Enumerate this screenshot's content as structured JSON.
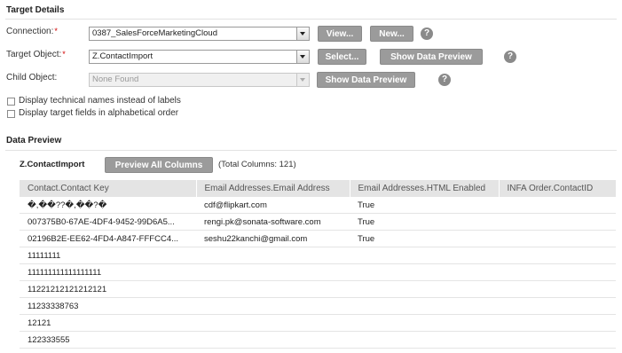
{
  "target_details": {
    "title": "Target Details",
    "connection": {
      "label": "Connection:",
      "required_mark": "*",
      "value": "0387_SalesForceMarketingCloud",
      "view_label": "View...",
      "new_label": "New..."
    },
    "target_object": {
      "label": "Target Object:",
      "required_mark": "*",
      "value": "Z.ContactImport",
      "select_label": "Select...",
      "preview_label": "Show Data Preview"
    },
    "child_object": {
      "label": "Child Object:",
      "value": "None Found",
      "preview_label": "Show Data Preview"
    },
    "help_glyph": "?",
    "options": [
      {
        "label": "Display technical names instead of labels",
        "checked": false
      },
      {
        "label": "Display target fields in alphabetical order",
        "checked": false
      }
    ]
  },
  "data_preview": {
    "title": "Data Preview",
    "object_name": "Z.ContactImport",
    "preview_all_label": "Preview All Columns",
    "total_columns": "(Total Columns: 121)",
    "columns": [
      "Contact.Contact Key",
      "Email Addresses.Email Address",
      "Email Addresses.HTML Enabled",
      "INFA Order.ContactID"
    ],
    "rows": [
      [
        "�,��??�,��?�",
        "cdf@flipkart.com",
        "True",
        ""
      ],
      [
        "007375B0-67AE-4DF4-9452-99D6A5...",
        "rengi.pk@sonata-software.com",
        "True",
        ""
      ],
      [
        "02196B2E-EE62-4FD4-A847-FFFCC4...",
        "seshu22kanchi@gmail.com",
        "True",
        ""
      ],
      [
        "11111111",
        "",
        "",
        ""
      ],
      [
        "111111111111111111",
        "",
        "",
        ""
      ],
      [
        "11221212121212121",
        "",
        "",
        ""
      ],
      [
        "11233338763",
        "",
        "",
        ""
      ],
      [
        "12121",
        "",
        "",
        ""
      ],
      [
        "122333555",
        "",
        "",
        ""
      ]
    ]
  }
}
